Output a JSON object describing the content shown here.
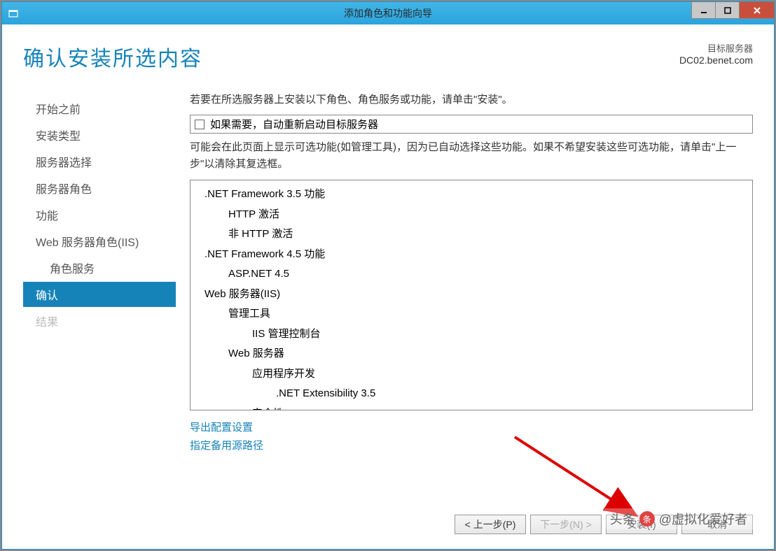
{
  "window": {
    "title": "添加角色和功能向导"
  },
  "page": {
    "title": "确认安装所选内容",
    "target_label": "目标服务器",
    "target_name": "DC02.benet.com"
  },
  "sidebar": {
    "items": [
      {
        "label": "开始之前",
        "indent": false,
        "active": false,
        "disabled": false
      },
      {
        "label": "安装类型",
        "indent": false,
        "active": false,
        "disabled": false
      },
      {
        "label": "服务器选择",
        "indent": false,
        "active": false,
        "disabled": false
      },
      {
        "label": "服务器角色",
        "indent": false,
        "active": false,
        "disabled": false
      },
      {
        "label": "功能",
        "indent": false,
        "active": false,
        "disabled": false
      },
      {
        "label": "Web 服务器角色(IIS)",
        "indent": false,
        "active": false,
        "disabled": false
      },
      {
        "label": "角色服务",
        "indent": true,
        "active": false,
        "disabled": false
      },
      {
        "label": "确认",
        "indent": false,
        "active": true,
        "disabled": false
      },
      {
        "label": "结果",
        "indent": false,
        "active": false,
        "disabled": true
      }
    ]
  },
  "instruction": "若要在所选服务器上安装以下角色、角色服务或功能，请单击\"安装\"。",
  "checkbox_label": "如果需要，自动重新启动目标服务器",
  "note": "可能会在此页面上显示可选功能(如管理工具)，因为已自动选择这些功能。如果不希望安装这些可选功能，请单击\"上一步\"以清除其复选框。",
  "features": [
    {
      "text": ".NET Framework 3.5 功能",
      "level": 0
    },
    {
      "text": "HTTP 激活",
      "level": 1
    },
    {
      "text": "非 HTTP 激活",
      "level": 1
    },
    {
      "text": ".NET Framework 4.5 功能",
      "level": 0
    },
    {
      "text": "ASP.NET 4.5",
      "level": 1
    },
    {
      "text": "Web 服务器(IIS)",
      "level": 0
    },
    {
      "text": "管理工具",
      "level": 1
    },
    {
      "text": "IIS 管理控制台",
      "level": 2
    },
    {
      "text": "Web 服务器",
      "level": 1
    },
    {
      "text": "应用程序开发",
      "level": 2
    },
    {
      "text": ".NET Extensibility 3.5",
      "level": 3
    },
    {
      "text": "安全性",
      "level": 2
    }
  ],
  "links": {
    "export": "导出配置设置",
    "alternate": "指定备用源路径"
  },
  "buttons": {
    "prev": "< 上一步(P)",
    "next": "下一步(N) >",
    "install": "安装(I)",
    "cancel": "取消"
  },
  "watermark": {
    "prefix": "头条",
    "text": "@虚拟化爱好者"
  }
}
